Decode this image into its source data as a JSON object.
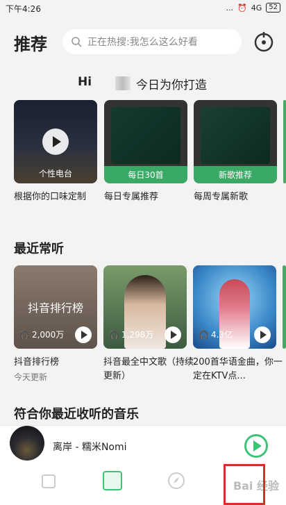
{
  "status": {
    "time": "下午4:26",
    "battery": "52",
    "dots": "...",
    "signal": "4G"
  },
  "header": {
    "title": "推荐",
    "search_placeholder": "正在热搜:我怎么这么好看"
  },
  "greeting": {
    "hi": "Hi",
    "message": "今日为你打造"
  },
  "recommend": [
    {
      "label": "个性电台",
      "caption": "根据你的口味定制"
    },
    {
      "label": "每日30首",
      "caption": "每日专属推荐"
    },
    {
      "label": "新歌推荐",
      "caption": "每周专属新歌"
    }
  ],
  "recent": {
    "title": "最近常听",
    "items": [
      {
        "cover_text": "抖音排行榜",
        "count": "2,000万",
        "title": "抖音排行榜",
        "sub": "今天更新"
      },
      {
        "cover_text": "",
        "count": "1,298万",
        "title": "抖音最全中文歌（持续更新）",
        "sub": ""
      },
      {
        "cover_text": "",
        "count": "4.3亿",
        "title": "200首华语金曲，你一定在KTV点...",
        "sub": ""
      }
    ]
  },
  "section3": {
    "title": "符合你最近收听的音乐"
  },
  "player": {
    "song": "离岸 - 糯米Nomi"
  },
  "tabs": [
    "music-icon",
    "discover-icon",
    "compass-icon",
    "profile-icon"
  ],
  "watermark": "Bai 经验",
  "colors": {
    "accent": "#3bc476",
    "highlight": "#d4302a"
  }
}
